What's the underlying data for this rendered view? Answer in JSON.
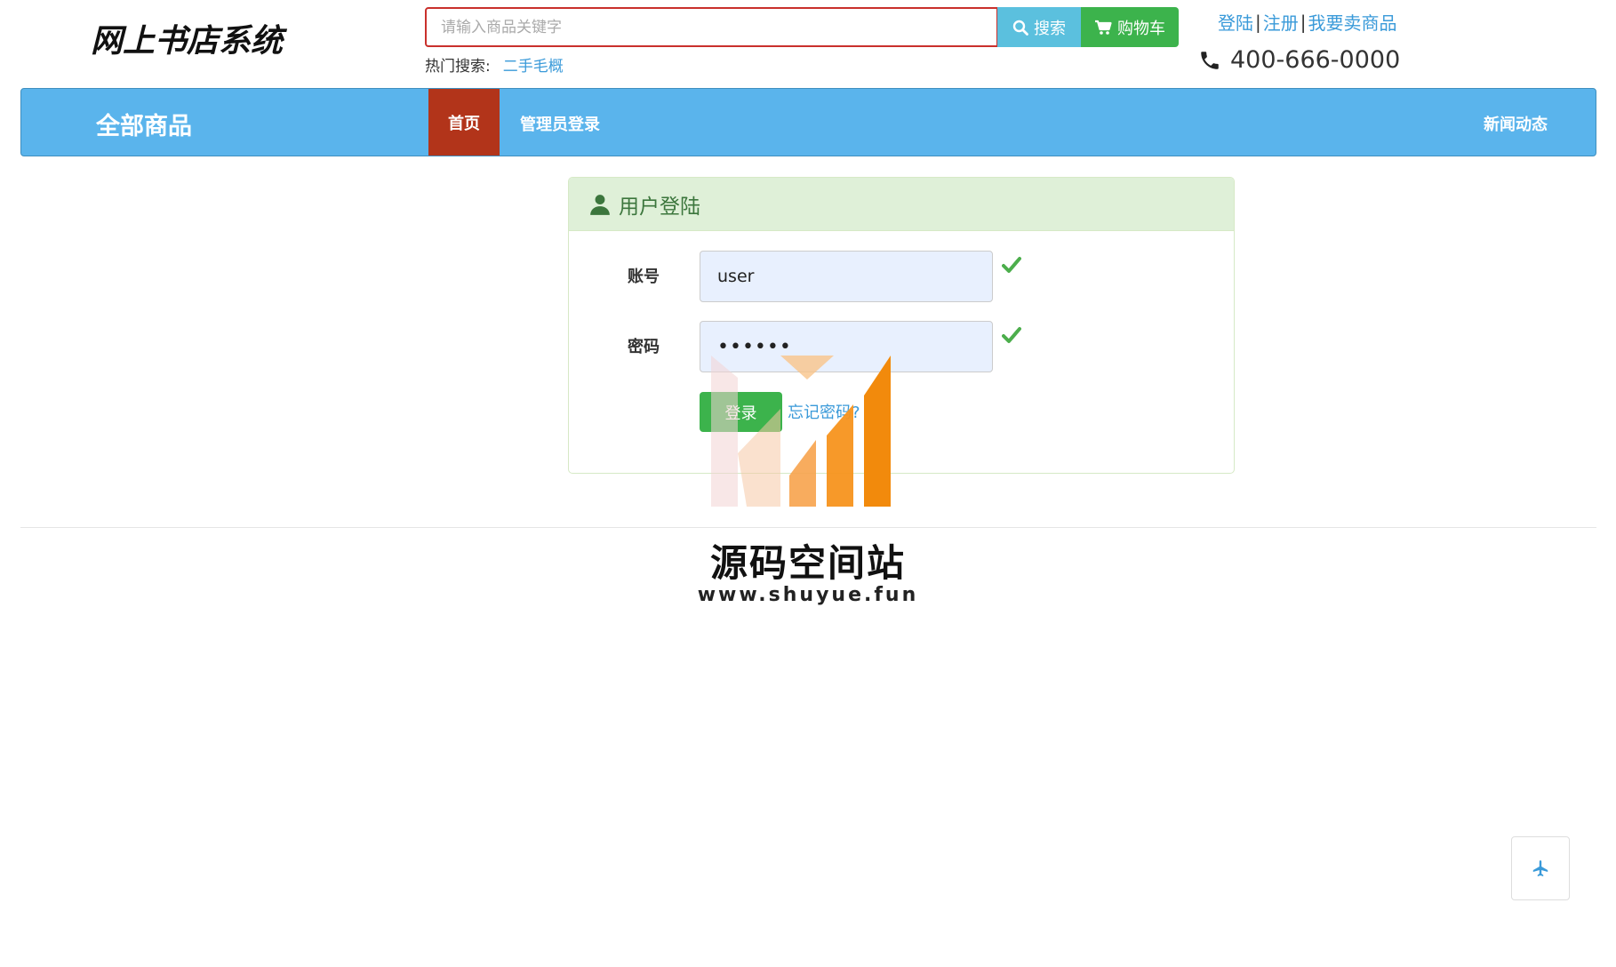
{
  "header": {
    "logo_text": "网上书店系统",
    "search": {
      "placeholder": "请输入商品关键字",
      "value": ""
    },
    "search_button": "搜索",
    "cart_button": "购物车",
    "hot_search_label": "热门搜索:",
    "hot_search_items": [
      "二手毛概"
    ],
    "top_links": [
      "登陆",
      "注册",
      "我要卖商品"
    ],
    "phone_number": "400-666-0000"
  },
  "nav": {
    "brand": "全部商品",
    "items": [
      {
        "label": "首页",
        "active": true
      },
      {
        "label": "管理员登录",
        "active": false
      },
      {
        "label": "新闻动态",
        "active": false
      }
    ]
  },
  "login": {
    "title": "用户登陆",
    "account_label": "账号",
    "account_value": "user",
    "password_label": "密码",
    "password_value": "••••••",
    "submit_label": "登录",
    "forgot_label": "忘记密码?"
  },
  "watermark": {
    "title": "源码空间站",
    "url": "www.shuyue.fun"
  },
  "colors": {
    "nav_bg": "#5ab4ec",
    "nav_active": "#b2341a",
    "search_btn": "#5bc0de",
    "cart_btn": "#3cb34c",
    "panel_heading": "#dff0d8",
    "panel_text": "#3c763d",
    "link": "#3a9ad9"
  },
  "icons": [
    "search-icon",
    "cart-icon",
    "phone-icon",
    "user-icon",
    "check-icon",
    "plane-icon"
  ]
}
